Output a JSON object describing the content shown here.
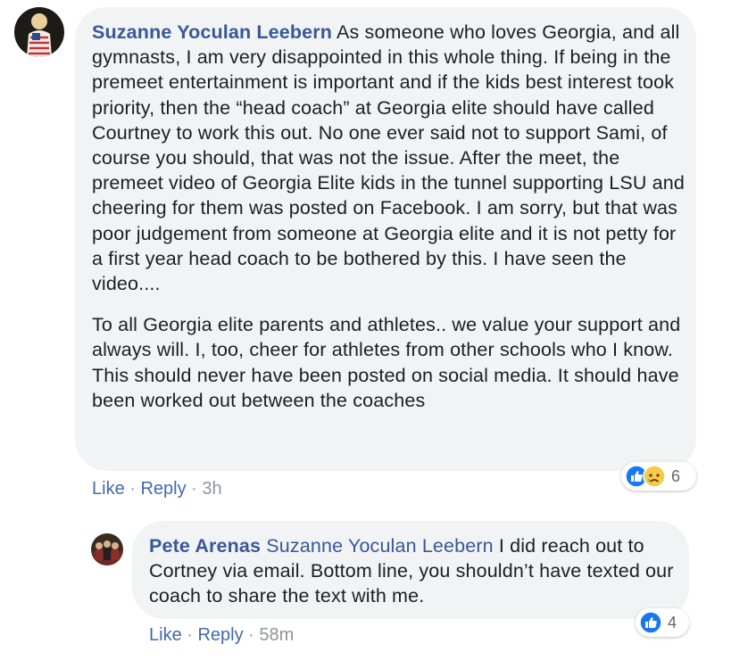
{
  "comment": {
    "author": "Suzanne Yoculan Leebern",
    "body_p1": "As someone who loves Georgia, and all gymnasts, I am very disappointed in this whole thing. If being in the premeet entertainment is important and if the kids best interest took priority, then the “head coach” at Georgia elite should have called Courtney to work this out. No one ever said not to support Sami, of course you should, that was not the issue. After the meet, the premeet video of Georgia Elite kids in the tunnel supporting LSU and cheering for them was posted on Facebook. I am sorry, but that was poor judgement from someone at Georgia elite and it is not petty for a first year head coach to be bothered by this. I have seen the video....",
    "body_p2": "To all Georgia elite parents and athletes.. we value your support and always will. I, too, cheer for athletes from other schools who I know. This should never have been posted on social media. It should have been worked out between the coaches",
    "like_label": "Like",
    "reply_label": "Reply",
    "separator": " · ",
    "time": "3h",
    "reaction_icons": [
      "like-icon",
      "sad-icon"
    ],
    "reaction_count": "6"
  },
  "reply": {
    "author": "Pete Arenas",
    "mention": "Suzanne Yoculan Leebern",
    "body": "I did reach out to Cortney via email. Bottom line, you shouldn’t have texted our coach to share the text with me.",
    "like_label": "Like",
    "reply_label": "Reply",
    "separator": " · ",
    "time": "58m",
    "reaction_icons": [
      "like-icon"
    ],
    "reaction_count": "4"
  },
  "colors": {
    "name_link": "#385898",
    "action_link": "#4267b2",
    "bubble_bg": "#f2f3f5",
    "meta_text": "#90949c",
    "like_blue": "#1877f2",
    "sad_yellow": "#f7c94a"
  }
}
